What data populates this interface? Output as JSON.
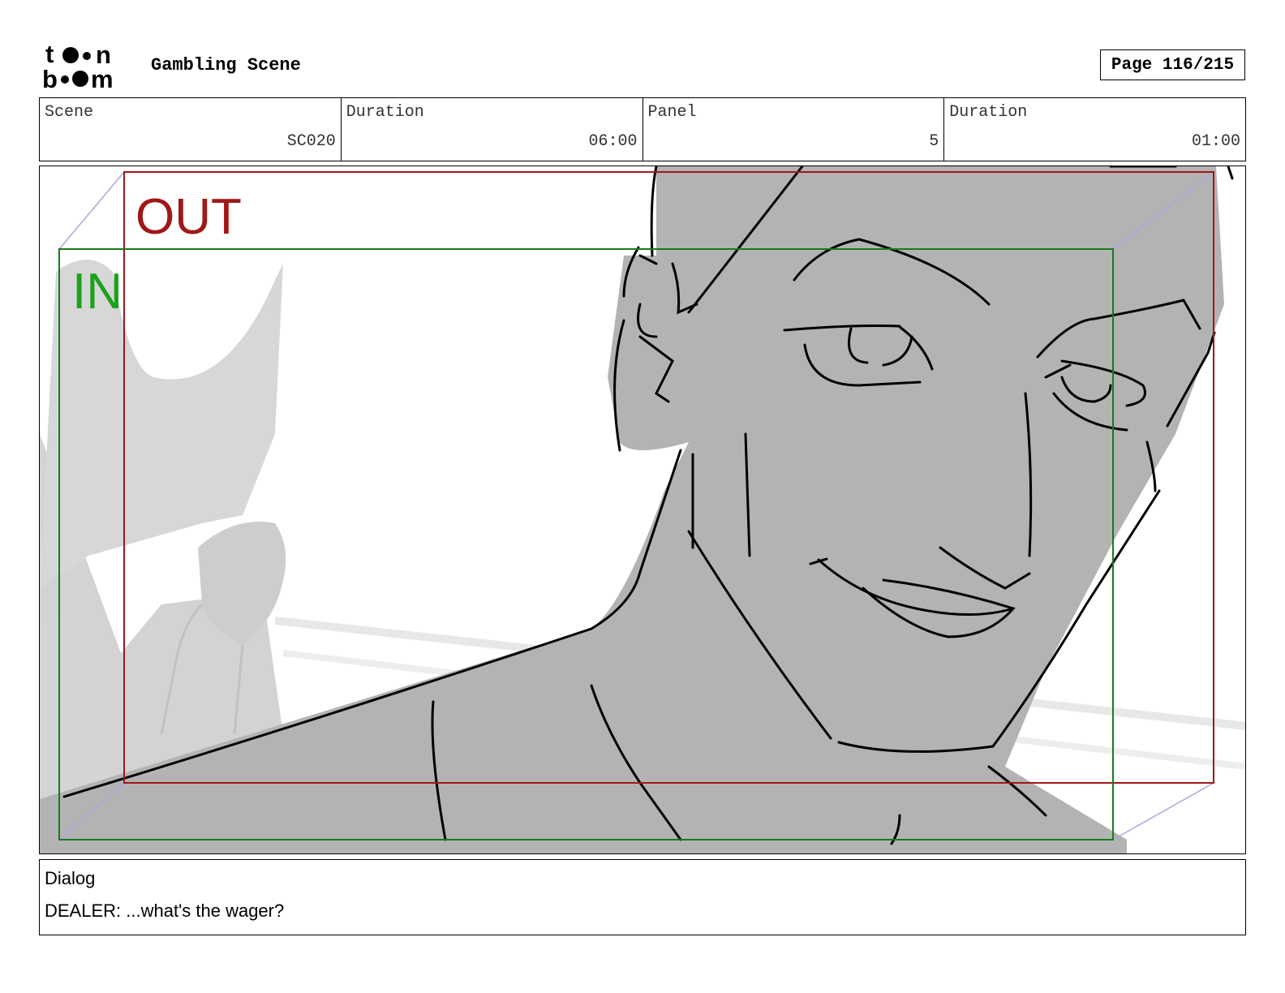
{
  "header": {
    "logo_text": "toon boom",
    "title": "Gambling Scene",
    "page": "Page 116/215"
  },
  "meta": {
    "scene_label": "Scene",
    "scene_value": "SC020",
    "scene_duration_label": "Duration",
    "scene_duration_value": "06:00",
    "panel_label": "Panel",
    "panel_value": "5",
    "panel_duration_label": "Duration",
    "panel_duration_value": "01:00"
  },
  "panel": {
    "out_label": "OUT",
    "in_label": "IN",
    "colors": {
      "out_frame": "#a11717",
      "in_frame": "#1a7a1a",
      "in_text": "#1aa31a",
      "sketch_fill": "#b3b3b3",
      "background_figure": "#cccccc"
    }
  },
  "dialog": {
    "label": "Dialog",
    "text": "DEALER: ...what's the wager?"
  }
}
